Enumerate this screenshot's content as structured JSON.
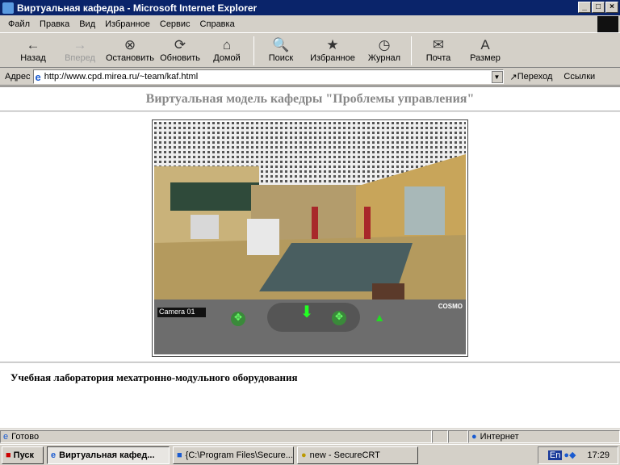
{
  "window": {
    "title": "Виртуальная кафедра - Microsoft Internet Explorer",
    "minimize": "_",
    "maximize": "□",
    "close": "×"
  },
  "menu": [
    "Файл",
    "Правка",
    "Вид",
    "Избранное",
    "Сервис",
    "Справка"
  ],
  "toolbar": [
    {
      "label": "Назад",
      "icon": "←",
      "disabled": false
    },
    {
      "label": "Вперед",
      "icon": "→",
      "disabled": true
    },
    {
      "label": "Остановить",
      "icon": "⊗",
      "disabled": false
    },
    {
      "label": "Обновить",
      "icon": "⟳",
      "disabled": false
    },
    {
      "label": "Домой",
      "icon": "⌂",
      "disabled": false
    },
    {
      "label": "Поиск",
      "icon": "🔍",
      "disabled": false
    },
    {
      "label": "Избранное",
      "icon": "★",
      "disabled": false
    },
    {
      "label": "Журнал",
      "icon": "◷",
      "disabled": false
    },
    {
      "label": "Почта",
      "icon": "✉",
      "disabled": false
    },
    {
      "label": "Размер",
      "icon": "A",
      "disabled": false
    }
  ],
  "address": {
    "label": "Адрес",
    "url": "http://www.cpd.mirea.ru/~team/kaf.html",
    "go": "Переход",
    "links": "Ссылки"
  },
  "page": {
    "heading": "Виртуальная модель кафедры \"Проблемы управления\"",
    "viewer": {
      "camera": "Camera 01",
      "logo": "COSMO"
    },
    "caption": "Учебная лаборатория мехатронно-модульного оборудования"
  },
  "status": {
    "text": "Готово",
    "zone": "Интернет"
  },
  "taskbar": {
    "start": "Пуск",
    "tasks": [
      "Виртуальная кафед...",
      "{C:\\Program Files\\Secure...",
      "new - SecureCRT"
    ],
    "lang": "En",
    "time": "17:29"
  }
}
